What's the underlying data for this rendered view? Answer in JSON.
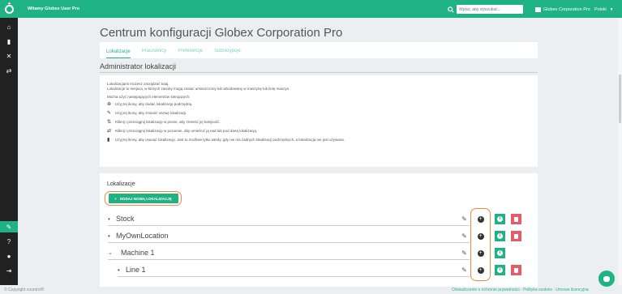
{
  "header": {
    "welcome": "Witamy Globex User Pro",
    "search_placeholder": "Wpisz, aby wyszukać...",
    "company": "Globex Corporation Pro",
    "language": "Polski"
  },
  "page": {
    "title": "Centrum konfiguracji Globex Corporation Pro",
    "tabs": [
      "Lokalizacje",
      "Pracownicy",
      "Preferencje",
      "Subskrypcje"
    ],
    "section_title": "Administrator lokalizacji"
  },
  "info": {
    "line1": "Lokalizacjami możesz zarządzać tutaj.",
    "line2": "Lokalizacje to miejsca, w których zasoby mogą zostać umieszczony lub wbudowany w maszynę lub linię maszyn.",
    "line3": "Można użyć następujących elementów sterujących:",
    "items": [
      {
        "icon": "add-circle-icon",
        "text": "Użyj tej ikony, aby dodać lokalizację podrzędną."
      },
      {
        "icon": "pencil-icon",
        "text": "Użyj tej ikony, aby zmienić nazwę lokalizacji."
      },
      {
        "icon": "vertical-arrows-icon",
        "text": "Kliknij i przeciągnij lokalizację w pionie, aby zmienić jej kolejność."
      },
      {
        "icon": "horizontal-arrows-icon",
        "text": "Kliknij i przeciągnij lokalizację w poziomie, aby umieścić ją nad lub pod daną lokalizacją."
      },
      {
        "icon": "trash-icon",
        "text": "Użyj tej ikony, aby usunąć lokalizację. Jest to możliwe tylko wtedy, gdy nie ma żadnych lokalizacji podrzędnych, a lokalizacja nie jest używana."
      }
    ]
  },
  "locations": {
    "title": "Lokalizacje",
    "add_button": "DODAJ NOWĄ LOKALIZACJĘ",
    "rows": [
      {
        "name": "Stock",
        "marker": "•"
      },
      {
        "name": "MyOwnLocation",
        "marker": "•"
      },
      {
        "name": "Machine 1",
        "marker": "⌄"
      },
      {
        "name": "Line 1",
        "marker": "•"
      }
    ]
  },
  "footer": {
    "copyright": "© Copyright countrol®",
    "links": "Oświadczenie o ochronie prywatności · Polityka cookies · Umowa licencyjna"
  },
  "colors": {
    "accent": "#1fb384",
    "danger": "#e35d6a",
    "highlight": "#f0883a",
    "sidebar": "#212121"
  }
}
